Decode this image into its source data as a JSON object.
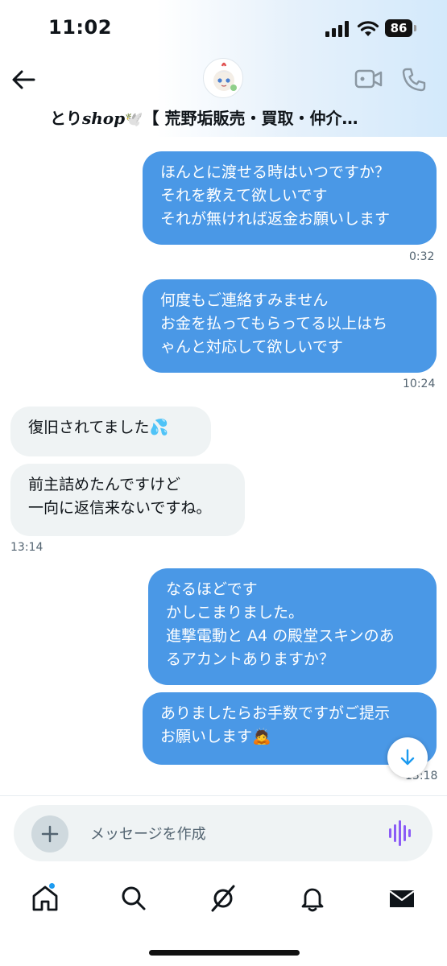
{
  "status_bar": {
    "time": "11:02",
    "battery": "86"
  },
  "header": {
    "title_part1": "とり",
    "title_part2": "shop",
    "title_part3": "🕊️",
    "title_part4": "【 荒野垢販売・買取・仲介…"
  },
  "messages": [
    {
      "side": "sent",
      "text": "ほんとに渡せる時はいつですか？\nそれを教えて欲しいです\nそれが無ければ返金お願いします",
      "time": "0:32"
    },
    {
      "side": "sent",
      "text": "何度もご連絡すみません\nお金を払ってもらってる以上はち\nゃんと対応して欲しいです",
      "time": "10:24"
    },
    {
      "side": "received",
      "text": "復旧されてました💦"
    },
    {
      "side": "received",
      "text": "前主詰めたんですけど\n一向に返信来ないですね。",
      "time": "13:14"
    },
    {
      "side": "sent",
      "text": "なるほどです\nかしこまりました。\n進撃電動と A4 の殿堂スキンのあ\nるアカントありますか？"
    },
    {
      "side": "sent",
      "text": "ありましたらお手数ですがご提示\nお願いします🙇",
      "time": "13:18"
    }
  ],
  "composer": {
    "placeholder": "メッセージを作成"
  },
  "bottom_nav": {
    "items": [
      "home-icon",
      "search-icon",
      "grok-icon",
      "notifications-icon",
      "messages-icon"
    ]
  },
  "colors": {
    "sent_bubble": "#4a98e6",
    "received_bubble": "#eff3f4",
    "accent": "#1d9bf0"
  }
}
